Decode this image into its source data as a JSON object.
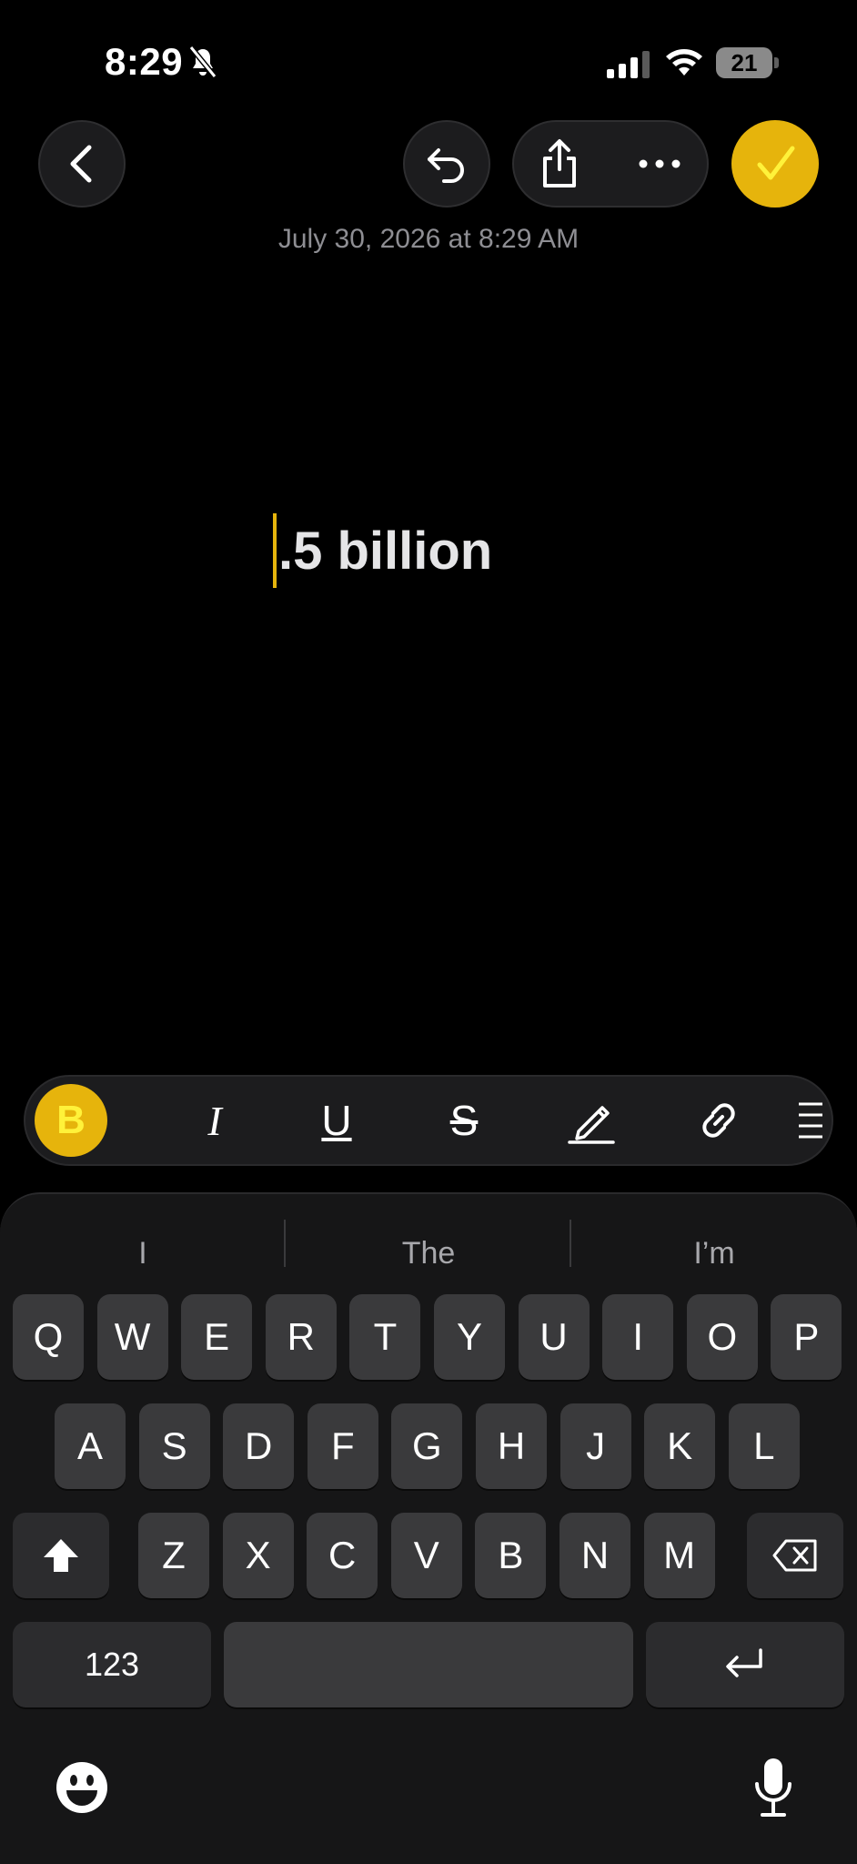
{
  "status_bar": {
    "time": "8:29",
    "battery": "21"
  },
  "note": {
    "timestamp": "July 30, 2026 at 8:29 AM",
    "content": ".5 billion"
  },
  "format_toolbar": {
    "bold": "B",
    "italic": "I",
    "underline": "U",
    "strikethrough": "S"
  },
  "suggestions": [
    "I",
    "The",
    "I’m"
  ],
  "keyboard": {
    "row1": [
      "Q",
      "W",
      "E",
      "R",
      "T",
      "Y",
      "U",
      "I",
      "O",
      "P"
    ],
    "row2": [
      "A",
      "S",
      "D",
      "F",
      "G",
      "H",
      "J",
      "K",
      "L"
    ],
    "row3": [
      "Z",
      "X",
      "C",
      "V",
      "B",
      "N",
      "M"
    ],
    "numbers_key": "123"
  },
  "colors": {
    "accent": "#e6b40c",
    "background": "#000000",
    "key": "#3a3a3c"
  }
}
